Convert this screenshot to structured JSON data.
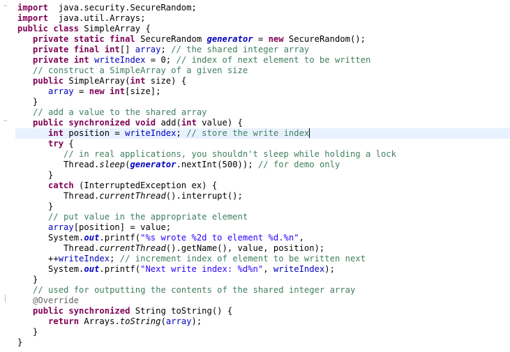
{
  "editor": {
    "lines": [
      [
        [
          "kw",
          "import"
        ],
        [
          "",
          "  java.security.SecureRandom;"
        ]
      ],
      [
        [
          "kw",
          "import"
        ],
        [
          "",
          "  java.util.Arrays;"
        ]
      ],
      [
        [
          "kw",
          "public class"
        ],
        [
          "",
          " SimpleArray {"
        ]
      ],
      [
        [
          "",
          "   "
        ],
        [
          "kw",
          "private static final"
        ],
        [
          "",
          " SecureRandom "
        ],
        [
          "sfld",
          "generator"
        ],
        [
          "",
          " = "
        ],
        [
          "kw",
          "new"
        ],
        [
          "",
          " SecureRandom();"
        ]
      ],
      [
        [
          "",
          "   "
        ],
        [
          "kw",
          "private final int"
        ],
        [
          "",
          "[] "
        ],
        [
          "fld",
          "array"
        ],
        [
          "",
          "; "
        ],
        [
          "cm",
          "// the shared integer array"
        ]
      ],
      [
        [
          "",
          "   "
        ],
        [
          "kw",
          "private int"
        ],
        [
          "",
          " "
        ],
        [
          "fld",
          "writeIndex"
        ],
        [
          "",
          " = 0; "
        ],
        [
          "cm",
          "// index of next element to be written"
        ]
      ],
      [
        [
          "",
          "   "
        ],
        [
          "cm",
          "// construct a SimpleArray of a given size"
        ]
      ],
      [
        [
          "",
          "   "
        ],
        [
          "kw",
          "public"
        ],
        [
          "",
          " SimpleArray("
        ],
        [
          "kw",
          "int"
        ],
        [
          "",
          " size) {"
        ]
      ],
      [
        [
          "",
          "      "
        ],
        [
          "fld",
          "array"
        ],
        [
          "",
          " = "
        ],
        [
          "kw",
          "new int"
        ],
        [
          "",
          "[size];"
        ]
      ],
      [
        [
          "",
          "   }"
        ]
      ],
      [
        [
          "",
          "   "
        ],
        [
          "cm",
          "// add a value to the shared array"
        ]
      ],
      [
        [
          "",
          "   "
        ],
        [
          "kw",
          "public synchronized void"
        ],
        [
          "",
          " add("
        ],
        [
          "kw",
          "int"
        ],
        [
          "",
          " value) {"
        ]
      ],
      [
        [
          "",
          "      "
        ],
        [
          "kw",
          "int"
        ],
        [
          "",
          " position = "
        ],
        [
          "fld",
          "writeIndex"
        ],
        [
          "",
          "; "
        ],
        [
          "cm",
          "// store the write index"
        ]
      ],
      [
        [
          "",
          "      "
        ],
        [
          "kw",
          "try"
        ],
        [
          "",
          " {"
        ]
      ],
      [
        [
          "",
          "         "
        ],
        [
          "cm",
          "// in real applications, you shouldn't sleep while holding a lock"
        ]
      ],
      [
        [
          "",
          "         Thread."
        ],
        [
          "it",
          "sleep"
        ],
        [
          "",
          "("
        ],
        [
          "sfld",
          "generator"
        ],
        [
          "",
          ".nextInt(500)); "
        ],
        [
          "cm",
          "// for demo only"
        ]
      ],
      [
        [
          "",
          "      }"
        ]
      ],
      [
        [
          "",
          "      "
        ],
        [
          "kw",
          "catch"
        ],
        [
          "",
          " (InterruptedException ex) {"
        ]
      ],
      [
        [
          "",
          "         Thread."
        ],
        [
          "it",
          "currentThread"
        ],
        [
          "",
          "().interrupt();"
        ]
      ],
      [
        [
          "",
          "      }"
        ]
      ],
      [
        [
          "",
          "      "
        ],
        [
          "cm",
          "// put value in the appropriate element"
        ]
      ],
      [
        [
          "",
          "      "
        ],
        [
          "fld",
          "array"
        ],
        [
          "",
          "[position] = value;"
        ]
      ],
      [
        [
          "",
          "      System."
        ],
        [
          "sfld",
          "out"
        ],
        [
          "",
          ".printf("
        ],
        [
          "str",
          "\"%s wrote %2d to element %d.%n\""
        ],
        [
          "",
          ","
        ]
      ],
      [
        [
          "",
          "         Thread."
        ],
        [
          "it",
          "currentThread"
        ],
        [
          "",
          "().getName(), value, position);"
        ]
      ],
      [
        [
          "",
          "      ++"
        ],
        [
          "fld",
          "writeIndex"
        ],
        [
          "",
          "; "
        ],
        [
          "cm",
          "// increment index of element to be written next"
        ]
      ],
      [
        [
          "",
          "      System."
        ],
        [
          "sfld",
          "out"
        ],
        [
          "",
          ".printf("
        ],
        [
          "str",
          "\"Next write index: %d%n\""
        ],
        [
          "",
          ", "
        ],
        [
          "fld",
          "writeIndex"
        ],
        [
          "",
          ");"
        ]
      ],
      [
        [
          "",
          "   }"
        ]
      ],
      [
        [
          "",
          "   "
        ],
        [
          "cm",
          "// used for outputting the contents of the shared integer array"
        ]
      ],
      [
        [
          "",
          "   "
        ],
        [
          "ann",
          "@Override"
        ]
      ],
      [
        [
          "",
          "   "
        ],
        [
          "kw",
          "public synchronized"
        ],
        [
          "",
          " String toString() {"
        ]
      ],
      [
        [
          "",
          "      "
        ],
        [
          "kw",
          "return"
        ],
        [
          "",
          " Arrays."
        ],
        [
          "it",
          "toString"
        ],
        [
          "",
          "("
        ],
        [
          "fld",
          "array"
        ],
        [
          "",
          ");"
        ]
      ],
      [
        [
          "",
          "   }"
        ]
      ],
      [
        [
          "",
          "}"
        ]
      ]
    ],
    "markers": {
      "0": "−",
      "11": "−",
      "28": "│"
    },
    "highlight_line": 12
  }
}
